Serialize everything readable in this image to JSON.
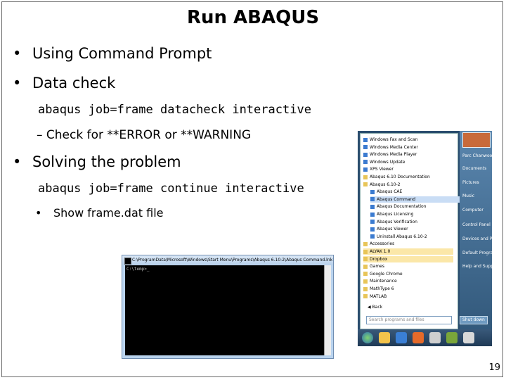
{
  "title": "Run ABAQUS",
  "bullets": {
    "b1": "Using Command Prompt",
    "b2": "Data check",
    "cmd1": "abaqus job=frame datacheck interactive",
    "sub1": "– Check for **ERROR or **WARNING",
    "b3": "Solving the problem",
    "cmd2": "abaqus job=frame continue interactive",
    "subsub1": "Show frame.dat file"
  },
  "cmd_window": {
    "title": "C:\\ProgramData\\Microsoft\\Windows\\Start Menu\\Programs\\Abaqus 6.10-2\\Abaqus Command.lnk",
    "prompt": "C:\\temp>_"
  },
  "start_menu": {
    "items": [
      {
        "label": "Windows Fax and Scan",
        "kind": "app"
      },
      {
        "label": "Windows Media Center",
        "kind": "app"
      },
      {
        "label": "Windows Media Player",
        "kind": "app"
      },
      {
        "label": "Windows Update",
        "kind": "app"
      },
      {
        "label": "XPS Viewer",
        "kind": "app"
      },
      {
        "label": "Abaqus 6.10 Documentation",
        "kind": "folder"
      },
      {
        "label": "Abaqus 6.10-2",
        "kind": "folder"
      },
      {
        "label": "Abaqus CAE",
        "kind": "sub"
      },
      {
        "label": "Abaqus Command",
        "kind": "sub-hl"
      },
      {
        "label": "Abaqus Documentation",
        "kind": "sub"
      },
      {
        "label": "Abaqus Licensing",
        "kind": "sub"
      },
      {
        "label": "Abaqus Verification",
        "kind": "sub"
      },
      {
        "label": "Abaqus Viewer",
        "kind": "sub"
      },
      {
        "label": "Uninstall Abaqus 6.10-2",
        "kind": "sub"
      },
      {
        "label": "Accessories",
        "kind": "folder"
      },
      {
        "label": "ALYAK 1.0",
        "kind": "folder-hl"
      },
      {
        "label": "Dropbox",
        "kind": "folder-hl"
      },
      {
        "label": "Games",
        "kind": "folder"
      },
      {
        "label": "Google Chrome",
        "kind": "folder"
      },
      {
        "label": "Maintenance",
        "kind": "folder"
      },
      {
        "label": "MathType 6",
        "kind": "folder"
      },
      {
        "label": "MATLAB",
        "kind": "folder"
      }
    ],
    "back": "Back",
    "search_placeholder": "Search programs and files",
    "shutdown": "Shut down",
    "right_items": [
      "Parc Chanwoo",
      "Documents",
      "Pictures",
      "Music",
      "Computer",
      "Control Panel",
      "Devices and Printers",
      "Default Programs",
      "Help and Support"
    ]
  },
  "colors": {
    "taskbar_icons": [
      "#f3c34b",
      "#3a7fd5",
      "#e56a2a",
      "#cfcfcf",
      "#7aa63a",
      "#d9d9d9"
    ]
  },
  "page_number": "19"
}
